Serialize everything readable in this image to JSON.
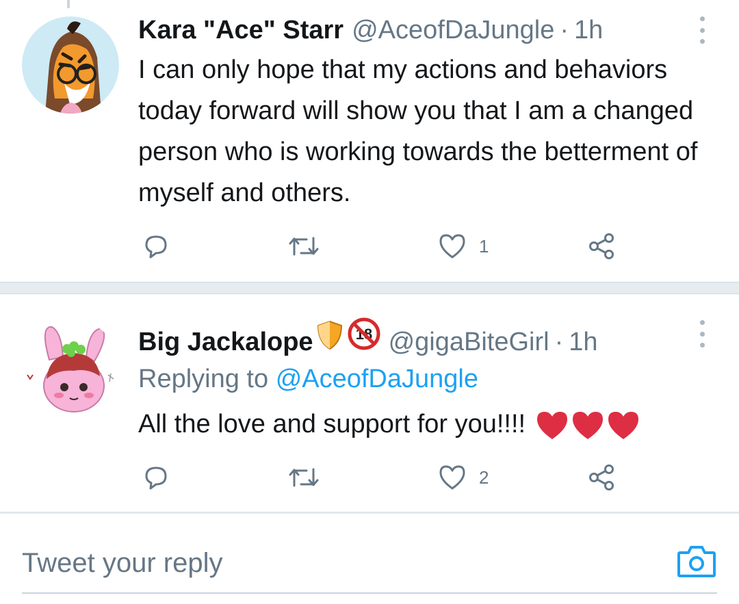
{
  "tweets": [
    {
      "display_name": "Kara \"Ace\" Starr",
      "handle": "@AceofDaJungle",
      "separator": "·",
      "time": "1h",
      "text": "I can only hope that my actions and behaviors today forward will show you that I am a changed person who is working towards the betterment of myself and others.",
      "like_count": "1",
      "avatar_icon": "tiger-avatar"
    },
    {
      "display_name": "Big Jackalope",
      "handle": "@gigaBiteGirl",
      "separator": "·",
      "time": "1h",
      "badges": [
        "shield-emoji",
        "no-under-18-emoji"
      ],
      "replying_prefix": "Replying to",
      "replying_handle": "@AceofDaJungle",
      "text": "All the love and support for you!!!!",
      "hearts": [
        "red-heart-emoji",
        "red-heart-emoji",
        "red-heart-emoji"
      ],
      "like_count": "2",
      "avatar_icon": "bunny-avatar"
    }
  ],
  "reply_box": {
    "placeholder": "Tweet your reply",
    "camera_icon": "camera-icon"
  },
  "colors": {
    "text_primary": "#14171a",
    "text_secondary": "#657786",
    "link": "#1da1f2",
    "icon_gray": "#657786",
    "heart_red": "#e0245e"
  }
}
